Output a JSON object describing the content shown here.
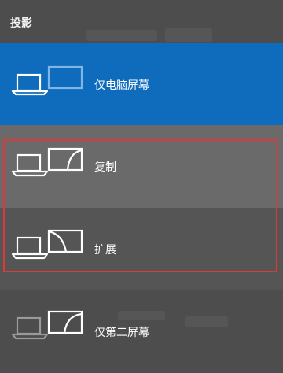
{
  "panel": {
    "title": "投影"
  },
  "options": [
    {
      "label": "仅电脑屏幕",
      "icon": "pc-screen-only-icon",
      "state": "selected"
    },
    {
      "label": "复制",
      "icon": "duplicate-icon",
      "state": "hover"
    },
    {
      "label": "扩展",
      "icon": "extend-icon",
      "state": "normal"
    },
    {
      "label": "仅第二屏幕",
      "icon": "second-screen-only-icon",
      "state": "normal"
    }
  ],
  "colors": {
    "accent": "#0f6cbd",
    "panel_bg": "#4d4d4d",
    "hover_bg": "#6a6a6a",
    "highlight_border": "#d93b3b"
  }
}
